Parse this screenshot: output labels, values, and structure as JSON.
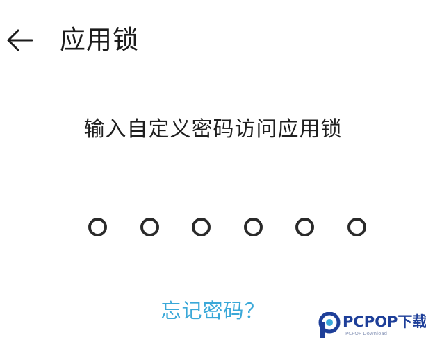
{
  "header": {
    "back_icon": "arrow-left-icon",
    "title": "应用锁"
  },
  "lock": {
    "prompt": "输入自定义密码访问应用锁",
    "pin_length": 6,
    "pin_entered": 0,
    "forgot_label": "忘记密码？"
  },
  "colors": {
    "background": "#ffffff",
    "text": "#1b1b1b",
    "link": "#3aa8d8",
    "watermark": "#1e3f99"
  },
  "watermark": {
    "brand": "PCPOP下载",
    "sub": "PCPOP Download"
  }
}
